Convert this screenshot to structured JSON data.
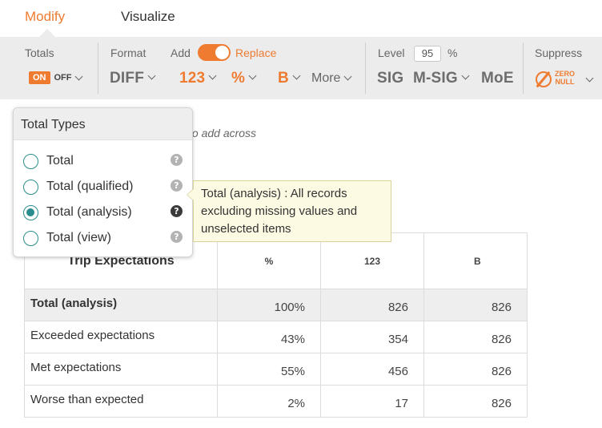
{
  "tabs": {
    "modify": "Modify",
    "visualize": "Visualize"
  },
  "toolbar": {
    "totals_label": "Totals",
    "on": "ON",
    "off": "OFF",
    "format_label": "Format",
    "format_value": "DIFF",
    "add_label": "Add",
    "replace_label": "Replace",
    "count_btn": "123",
    "percent_btn": "%",
    "base_btn": "B",
    "more_btn": "More",
    "level_label": "Level",
    "level_value": "95",
    "level_unit": "%",
    "sig_btn": "SIG",
    "msig_btn": "M-SIG",
    "moe_btn": "MoE",
    "suppress_label": "Suppress",
    "zero_label": "ZERO",
    "null_label": "NULL",
    "accent_color": "#ee7b30"
  },
  "hint_text": "to add across",
  "popup": {
    "title": "Total Types",
    "options": [
      {
        "label": "Total",
        "selected": false
      },
      {
        "label": "Total (qualified)",
        "selected": false
      },
      {
        "label": "Total (analysis)",
        "selected": true
      },
      {
        "label": "Total (view)",
        "selected": false
      }
    ],
    "help_glyph": "?",
    "radio_color": "#2a8c8c"
  },
  "tooltip": {
    "line1": "Total (analysis) : All records",
    "line2": "excluding missing values and",
    "line3": "unselected items"
  },
  "table": {
    "title": "Trip Expectations",
    "headers": [
      "%",
      "123",
      "B"
    ],
    "rows": [
      {
        "label": "Total (analysis)",
        "values": [
          "100%",
          "826",
          "826"
        ]
      },
      {
        "label": "Exceeded expectations",
        "values": [
          "43%",
          "354",
          "826"
        ]
      },
      {
        "label": "Met expectations",
        "values": [
          "55%",
          "456",
          "826"
        ]
      },
      {
        "label": "Worse than expected",
        "values": [
          "2%",
          "17",
          "826"
        ]
      }
    ]
  }
}
